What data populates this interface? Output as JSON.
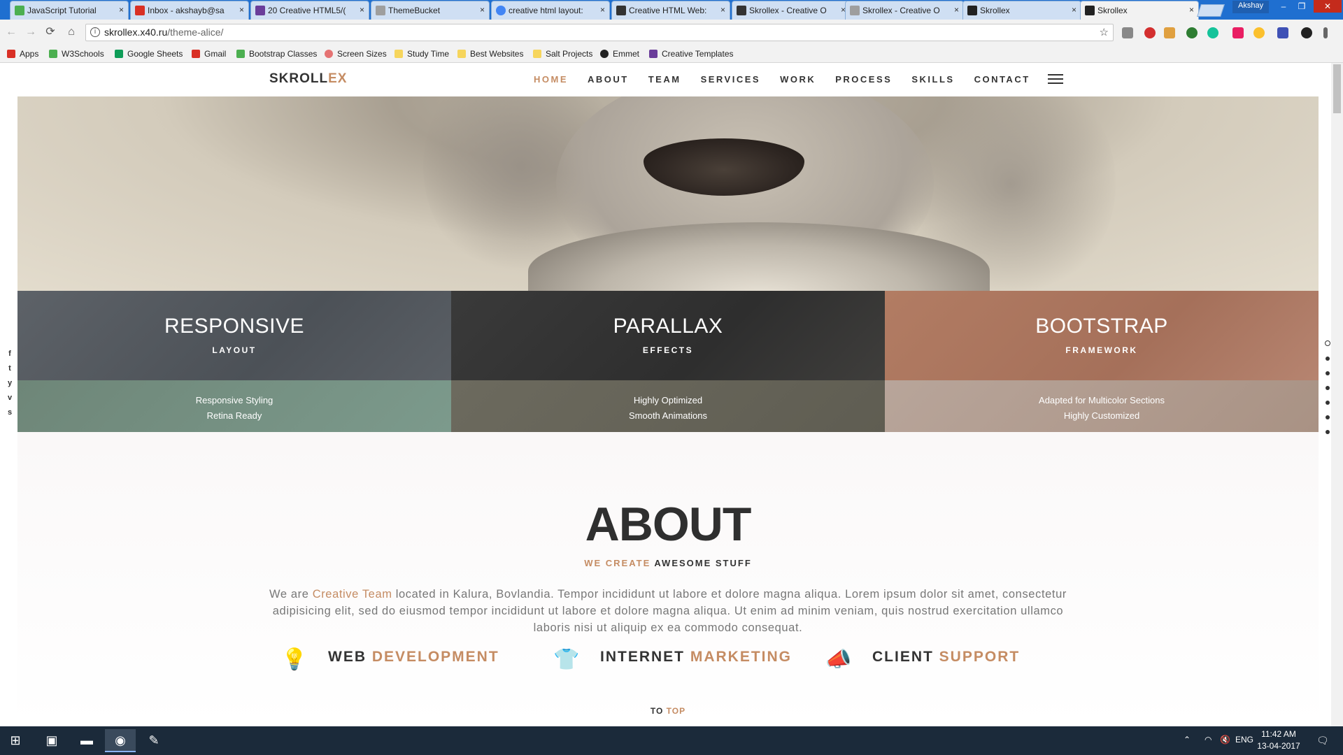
{
  "browser": {
    "tabs": [
      {
        "title": "JavaScript Tutorial",
        "color": "#4caf50"
      },
      {
        "title": "Inbox - akshayb@sa",
        "color": "#d93025"
      },
      {
        "title": "20 Creative HTML5/(",
        "color": "#6a3d9a"
      },
      {
        "title": "ThemeBucket",
        "color": "#9e9e9e"
      },
      {
        "title": "creative html layout:",
        "color": "#4285f4"
      },
      {
        "title": "Creative HTML Web:",
        "color": "#333333"
      },
      {
        "title": "Skrollex - Creative O",
        "color": "#333333"
      },
      {
        "title": "Skrollex - Creative O",
        "color": "#9e9e9e"
      },
      {
        "title": "Skrollex",
        "color": "#222222"
      },
      {
        "title": "Skrollex",
        "color": "#222222"
      }
    ],
    "close_glyph": "×",
    "user_name": "Akshay",
    "window_controls": [
      "‒",
      "❐",
      "✕"
    ],
    "url_host": "skrollex.x40.ru",
    "url_path": "/theme-alice/",
    "nav_icons": [
      "←",
      "→",
      "⟳",
      "⌂"
    ],
    "star_icon": "☆",
    "bookmarks": [
      {
        "label": "Apps",
        "color": "#d93025"
      },
      {
        "label": "W3Schools",
        "color": "#4caf50"
      },
      {
        "label": "Google Sheets",
        "color": "#0f9d58"
      },
      {
        "label": "Gmail",
        "color": "#d93025"
      },
      {
        "label": "Bootstrap Classes",
        "color": "#4caf50"
      },
      {
        "label": "Screen Sizes",
        "color": "#e57373"
      },
      {
        "label": "Study Time",
        "color": "#f6d55c"
      },
      {
        "label": "Best Websites",
        "color": "#f6d55c"
      },
      {
        "label": "Salt Projects",
        "color": "#f6d55c"
      },
      {
        "label": "Emmet",
        "color": "#222222"
      },
      {
        "label": "Creative Templates",
        "color": "#6a3d9a"
      }
    ]
  },
  "site": {
    "logo_main": "SKROLL",
    "logo_accent": "EX",
    "menu": [
      "HOME",
      "ABOUT",
      "TEAM",
      "SERVICES",
      "WORK",
      "PROCESS",
      "SKILLS",
      "CONTACT"
    ],
    "active_menu": "HOME",
    "features": [
      {
        "title": "RESPONSIVE",
        "subtitle": "LAYOUT",
        "line1": "Responsive Styling",
        "line2": "Retina Ready"
      },
      {
        "title": "PARALLAX",
        "subtitle": "EFFECTS",
        "line1": "Highly Optimized",
        "line2": "Smooth Animations"
      },
      {
        "title": "BOOTSTRAP",
        "subtitle": "FRAMEWORK",
        "line1": "Adapted for Multicolor Sections",
        "line2": "Highly Customized"
      }
    ],
    "about": {
      "heading": "ABOUT",
      "sub_accent": "WE CREATE",
      "sub_rest": " AWESOME STUFF",
      "body_pre": "We are ",
      "body_accent": "Creative Team",
      "body_rest": " located in Kalura, Bovlandia. Tempor incididunt ut labore et dolore magna aliqua. Lorem ipsum dolor sit amet, consectetur adipisicing elit, sed do eiusmod tempor incididunt ut labore et dolore magna aliqua. Ut enim ad minim veniam, quis nostrud exercitation ullamco laboris nisi ut aliquip ex ea commodo consequat."
    },
    "services": [
      {
        "icon": "lightbulb-icon",
        "glyph": "💡",
        "word1": "WEB ",
        "word2": "DEVELOPMENT"
      },
      {
        "icon": "tshirt-icon",
        "glyph": "👕",
        "word1": "INTERNET ",
        "word2": "MARKETING"
      },
      {
        "icon": "megaphone-icon",
        "glyph": "📣",
        "word1": "CLIENT ",
        "word2": "SUPPORT"
      }
    ],
    "to_top_a": "TO ",
    "to_top_b": "TOP",
    "social": [
      "f",
      "t",
      "y",
      "v",
      "s"
    ],
    "accent_color": "#c58c63"
  },
  "taskbar": {
    "lang": "ENG",
    "time": "11:42 AM",
    "date": "13-04-2017"
  }
}
